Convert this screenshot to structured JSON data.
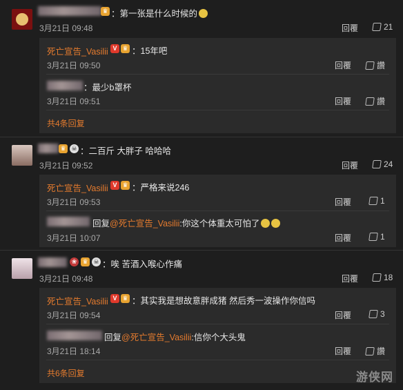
{
  "threads": [
    {
      "comment": {
        "sep": "：",
        "text": "第一张是什么时候的",
        "time": "3月21日 09:48",
        "reply_label": "回覆",
        "likes": "21"
      },
      "replies": [
        {
          "author": "死亡宣告_Vasilii",
          "text": "：15年吧",
          "time": "3月21日 09:50",
          "reply_label": "回覆",
          "like_label": "讚"
        },
        {
          "author": "",
          "text": "：最少b罩杯",
          "time": "3月21日 09:51",
          "reply_label": "回覆",
          "like_label": "讚"
        }
      ],
      "more": "共4条回复"
    },
    {
      "comment": {
        "sep": "：",
        "text": "二百斤 大胖子 哈哈哈",
        "time": "3月21日 09:52",
        "reply_label": "回覆",
        "likes": "24"
      },
      "replies": [
        {
          "author": "死亡宣告_Vasilii",
          "text": "：严格来说246",
          "time": "3月21日 09:53",
          "reply_label": "回覆",
          "likes": "1"
        },
        {
          "prefix": "回复",
          "mention": "@死亡宣告_Vasilii",
          "text": ":你这个体重太可怕了",
          "time": "3月21日 10:07",
          "reply_label": "回覆",
          "likes": "1"
        }
      ]
    },
    {
      "comment": {
        "sep": "：",
        "text": "唉 苦酒入喉心作痛",
        "time": "3月21日 09:48",
        "reply_label": "回覆",
        "likes": "18"
      },
      "replies": [
        {
          "author": "死亡宣告_Vasilii",
          "text": "：其实我是想故意胖成猪 然后秀一波操作你信吗",
          "time": "3月21日 09:54",
          "reply_label": "回覆",
          "likes": "3"
        },
        {
          "prefix": "回复",
          "mention": "@死亡宣告_Vasilii",
          "text": ":信你个大头鬼",
          "time": "3月21日 18:14",
          "reply_label": "回覆",
          "like_label": "讚"
        }
      ],
      "more": "共6条回复"
    }
  ],
  "watermark": "游侠网",
  "colors": {
    "background": "#1e1e1e",
    "reply_box": "#2b2b2b",
    "link": "#e57b2e",
    "text": "#d8d8d8"
  }
}
